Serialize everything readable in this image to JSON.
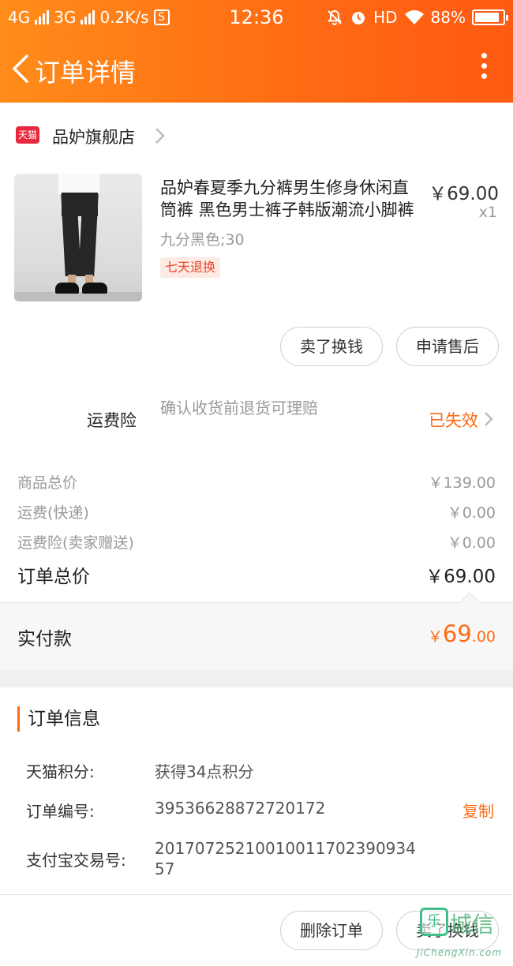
{
  "status_bar": {
    "network1": "4G",
    "network2": "3G",
    "speed": "0.2K/s",
    "s_badge": "S",
    "time": "12:36",
    "hd": "HD",
    "battery": "88%"
  },
  "nav": {
    "title": "订单详情"
  },
  "shop": {
    "logo_text": "天猫",
    "name": "品妒旗舰店"
  },
  "product": {
    "title": "品妒春夏季九分裤男生修身休闲直筒裤 黑色男士裤子韩版潮流小脚裤",
    "price": "￥69.00",
    "qty": "x1",
    "sku": "九分黑色;30",
    "tag": "七天退换"
  },
  "actions_top": {
    "sell_label": "卖了换钱",
    "aftersale_label": "申请售后"
  },
  "insurance": {
    "label": "运费险",
    "desc": "确认收货前退货可理赔",
    "status": "已失效"
  },
  "fees": {
    "goods_label": "商品总价",
    "goods_value": "￥139.00",
    "shipping_label": "运费(快递)",
    "shipping_value": "￥0.00",
    "insurance_label": "运费险(卖家赠送)",
    "insurance_value": "￥0.00",
    "total_label": "订单总价",
    "total_value": "￥69.00"
  },
  "paid": {
    "label": "实付款",
    "currency": "￥",
    "integer": "69",
    "decimal": ".00"
  },
  "order_info": {
    "title": "订单信息",
    "points_label": "天猫积分:",
    "points_value": "获得34点积分",
    "order_no_label": "订单编号:",
    "order_no_value": "39536628872720172",
    "copy_label": "复制",
    "trade_no_label": "支付宝交易号:",
    "trade_no_value": "20170725210010011702390934 57"
  },
  "actions_bottom": {
    "delete_label": "删除订单",
    "sell_label": "卖了换钱"
  },
  "watermark": {
    "mark": "乐",
    "text": "城信",
    "url": "JiChengXin.com"
  },
  "colors": {
    "accent": "#ff6a14",
    "tmall_red": "#e8283c"
  }
}
